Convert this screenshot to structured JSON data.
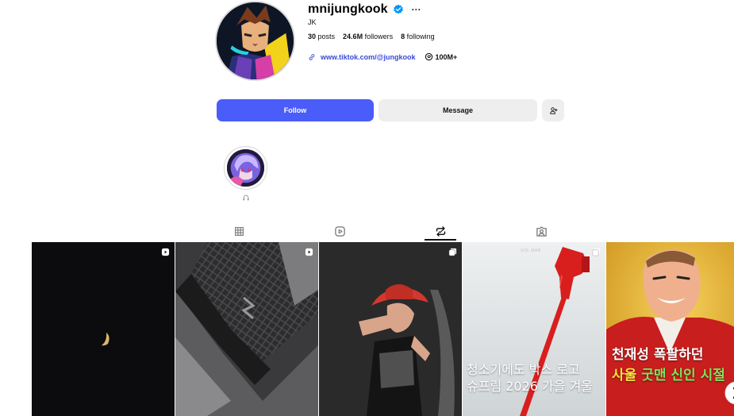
{
  "profile": {
    "username": "mnijungkook",
    "full_name": "JK",
    "posts_count": "30",
    "posts_label": "posts",
    "followers_count": "24.6M",
    "followers_label": "followers",
    "following_count": "8",
    "following_label": "following",
    "link": "www.tiktok.com/@jungkook",
    "threads_count": "100M+"
  },
  "actions": {
    "follow_label": "Follow",
    "message_label": "Message"
  },
  "highlights": [
    {
      "icon": "headphones-icon"
    }
  ],
  "tabs": [
    {
      "name": "posts",
      "icon": "grid-icon",
      "active": false
    },
    {
      "name": "reels",
      "icon": "reels-icon",
      "active": false
    },
    {
      "name": "reposts",
      "icon": "repost-icon",
      "active": true
    },
    {
      "name": "tagged",
      "icon": "tagged-icon",
      "active": false
    }
  ],
  "grid": [
    {
      "type": "reel",
      "icon": "reel-icon"
    },
    {
      "type": "reel",
      "icon": "reel-icon"
    },
    {
      "type": "carousel",
      "icon": "carousel-icon"
    },
    {
      "type": "carousel",
      "icon": "carousel-icon",
      "logo": "SOL MAR",
      "overlay_lines": [
        "청소기에도 박스 로고",
        "슈프림 2026 가을 겨울"
      ]
    },
    {
      "type": "post",
      "overlay_line1": "천재성 폭팔하던",
      "overlay_line2_a": "사울 ",
      "overlay_line2_b": "굿맨 신인 시절"
    }
  ],
  "colors": {
    "primary_button": "#4a5df9",
    "secondary_button": "#eeeeef",
    "link": "#3a4ad8",
    "verified_badge": "#0095f6"
  }
}
